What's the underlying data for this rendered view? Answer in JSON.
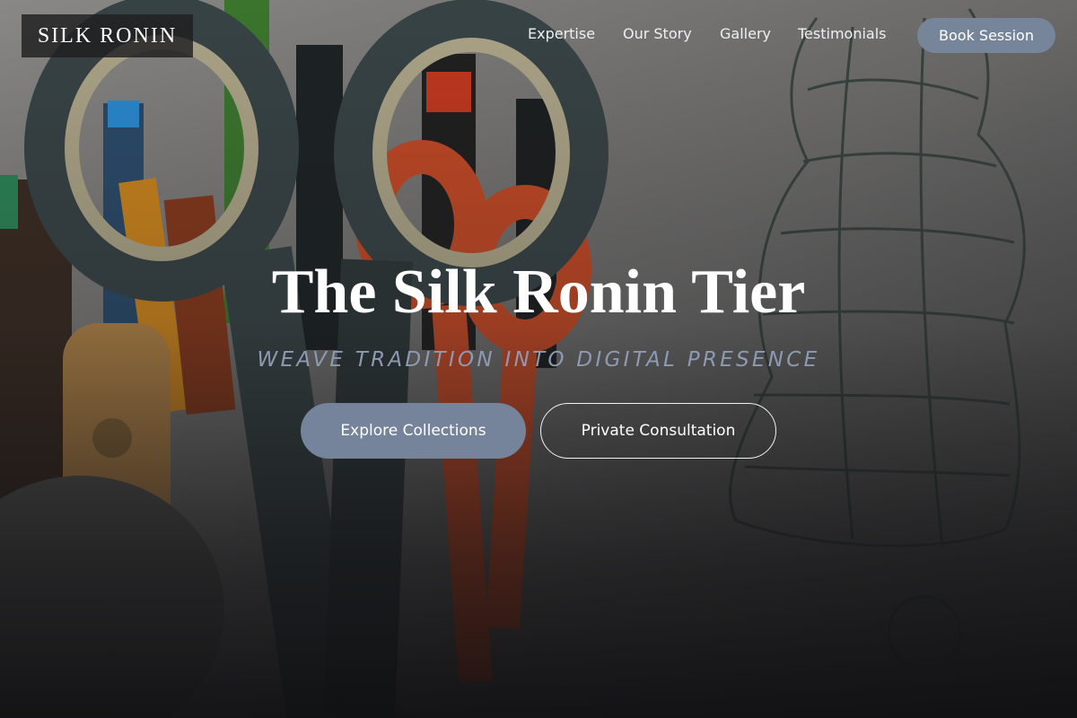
{
  "brand": {
    "logo_text": "SILK RONIN"
  },
  "nav": {
    "links": [
      {
        "label": "Expertise"
      },
      {
        "label": "Our Story"
      },
      {
        "label": "Gallery"
      },
      {
        "label": "Testimonials"
      }
    ],
    "cta_label": "Book Session"
  },
  "hero": {
    "title": "The Silk Ronin Tier",
    "tagline": "WEAVE TRADITION INTO DIGITAL PRESENCE",
    "primary_button": "Explore Collections",
    "secondary_button": "Private Consultation",
    "background_description_icon": "scissors-and-pencils-photo"
  },
  "colors": {
    "accent": "#76859a",
    "tagline": "#8c9bb3",
    "logo_bg": "#1e1e20",
    "text": "#ffffff"
  }
}
